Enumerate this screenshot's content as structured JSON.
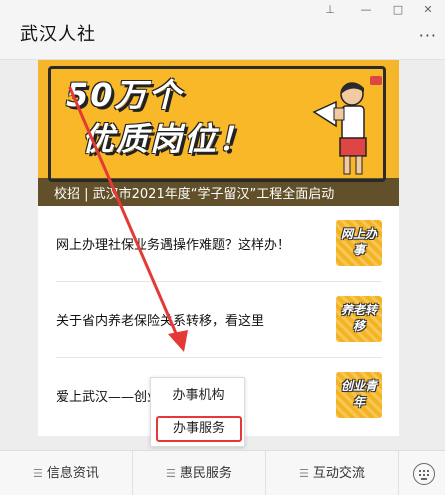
{
  "window": {
    "title": "武汉人社",
    "more_label": "···"
  },
  "banner": {
    "headline1": "50万个",
    "headline2": "优质岗位！",
    "caption": "校招 | 武汉市2021年度“学子留汉”工程全面启动"
  },
  "news": [
    {
      "text": "网上办理社保业务遇操作难题？这样办！",
      "thumb": "网上办事"
    },
    {
      "text": "关于省内养老保险关系转移，看这里",
      "thumb": "养老转移"
    },
    {
      "text": "爱上武汉——创业武汉的故事",
      "thumb": "创业青年"
    }
  ],
  "popup": {
    "items": [
      "办事机构",
      "办事服务"
    ]
  },
  "bottom_tabs": [
    "信息资讯",
    "惠民服务",
    "互动交流"
  ],
  "colors": {
    "annotation_red": "#e53935",
    "banner_yellow": "#f5b62b"
  }
}
